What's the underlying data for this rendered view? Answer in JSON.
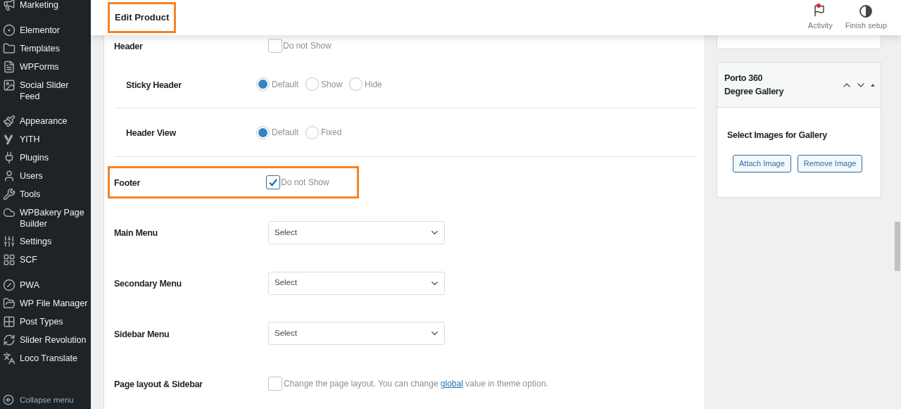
{
  "sidebar": {
    "groups": [
      {
        "items": [
          {
            "label": "Marketing"
          }
        ]
      },
      {
        "items": [
          {
            "label": "Elementor"
          },
          {
            "label": "Templates"
          },
          {
            "label": "WPForms"
          },
          {
            "label": "Social Slider Feed"
          }
        ]
      },
      {
        "items": [
          {
            "label": "Appearance"
          },
          {
            "label": "YITH"
          },
          {
            "label": "Plugins"
          },
          {
            "label": "Users"
          },
          {
            "label": "Tools"
          },
          {
            "label": "WPBakery Page Builder"
          },
          {
            "label": "Settings"
          },
          {
            "label": "SCF"
          }
        ]
      },
      {
        "items": [
          {
            "label": "PWA"
          },
          {
            "label": "WP File Manager"
          },
          {
            "label": "Post Types"
          },
          {
            "label": "Slider Revolution"
          },
          {
            "label": "Loco Translate"
          }
        ]
      }
    ],
    "collapse": "Collapse menu"
  },
  "topbar": {
    "title": "Edit Product",
    "title_highlighted": true,
    "actions": [
      {
        "label": "Activity",
        "notification": true
      },
      {
        "label": "Finish setup",
        "notification": false
      }
    ]
  },
  "settings": [
    {
      "kind": "checkbox",
      "label": "Header",
      "option": "Do not Show",
      "checked": false,
      "highlighted": false,
      "children": [
        {
          "kind": "radio",
          "label": "Sticky Header",
          "options": [
            {
              "label": "Default",
              "selected": true
            },
            {
              "label": "Show",
              "selected": false
            },
            {
              "label": "Hide",
              "selected": false
            }
          ]
        },
        {
          "kind": "radio",
          "label": "Header View",
          "options": [
            {
              "label": "Default",
              "selected": true
            },
            {
              "label": "Fixed",
              "selected": false
            }
          ]
        }
      ]
    },
    {
      "kind": "checkbox",
      "label": "Footer",
      "option": "Do not Show",
      "checked": true,
      "highlighted": true
    },
    {
      "kind": "select",
      "label": "Main Menu",
      "value": "Select"
    },
    {
      "kind": "select",
      "label": "Secondary Menu",
      "value": "Select"
    },
    {
      "kind": "select",
      "label": "Sidebar Menu",
      "value": "Select"
    },
    {
      "kind": "note",
      "label": "Page layout & Sidebar",
      "checked": false,
      "text_before": "Change the page layout. You can change ",
      "link": "global",
      "text_after": " value in theme option."
    }
  ],
  "gallery": {
    "title": [
      "Porto 360",
      "Degree Gallery"
    ],
    "heading": "Select Images for Gallery",
    "buttons": [
      "Attach Image",
      "Remove Image"
    ]
  }
}
